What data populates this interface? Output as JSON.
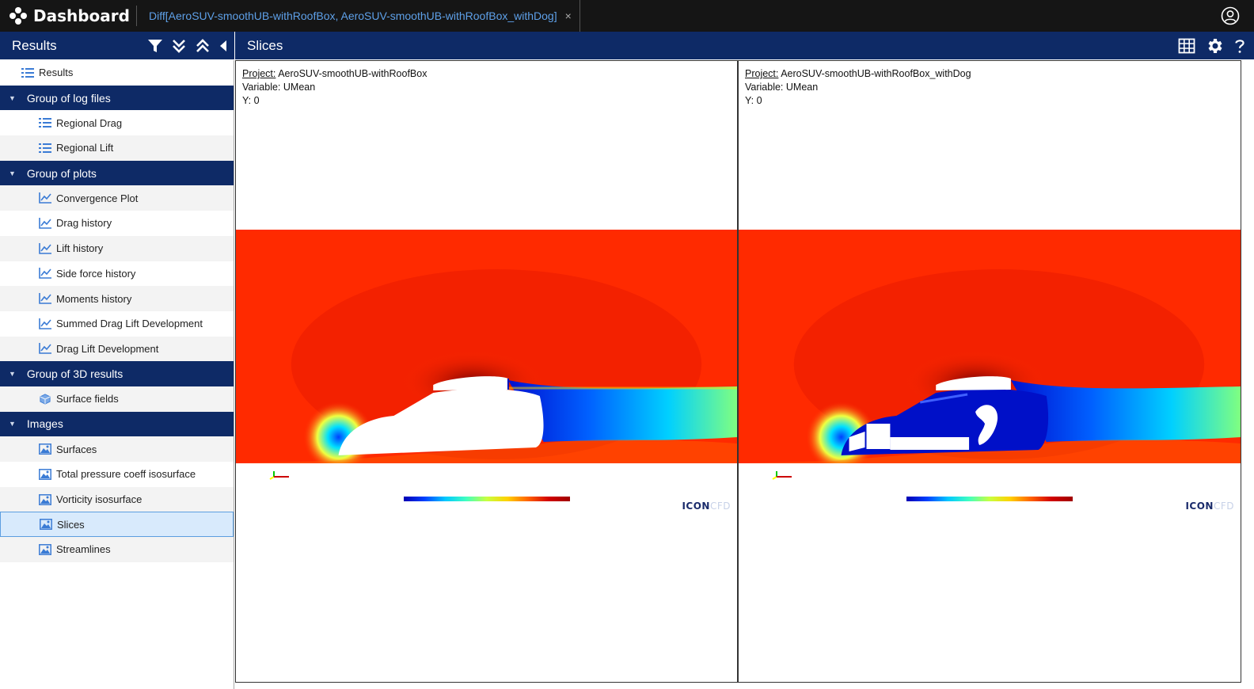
{
  "app": {
    "title": "Dashboard",
    "tab_label": "Diff[AeroSUV-smoothUB-withRoofBox, AeroSUV-smoothUB-withRoofBox_withDog]",
    "tab_close": "×"
  },
  "left_panel": {
    "title": "Results"
  },
  "main_panel": {
    "title": "Slices"
  },
  "tree": {
    "root": "Results",
    "groups": [
      {
        "label": "Group of log files",
        "items": [
          "Regional Drag",
          "Regional Lift"
        ]
      },
      {
        "label": "Group of plots",
        "items": [
          "Convergence Plot",
          "Drag history",
          "Lift history",
          "Side force history",
          "Moments history",
          "Summed Drag Lift Development",
          "Drag Lift Development"
        ]
      },
      {
        "label": "Group of 3D results",
        "items": [
          "Surface fields"
        ]
      },
      {
        "label": "Images",
        "items": [
          "Surfaces",
          "Total pressure coeff isosurface",
          "Vorticity isosurface",
          "Slices",
          "Streamlines"
        ]
      }
    ],
    "selected": "Slices"
  },
  "panes": [
    {
      "project_key": "Project:",
      "project": "AeroSUV-smoothUB-withRoofBox",
      "variable_line": "Variable: UMean",
      "y_line": "Y: 0"
    },
    {
      "project_key": "Project:",
      "project": "AeroSUV-smoothUB-withRoofBox_withDog",
      "variable_line": "Variable: UMean",
      "y_line": "Y: 0"
    }
  ],
  "colors": {
    "topbar": "#151515",
    "navy": "#0e2a66",
    "tab_link": "#5ea0e8",
    "selected_row": "#d8eafc",
    "flow_red": "#ff2a00"
  },
  "logo_text": {
    "bold": "ICON",
    "light": "CFD"
  }
}
